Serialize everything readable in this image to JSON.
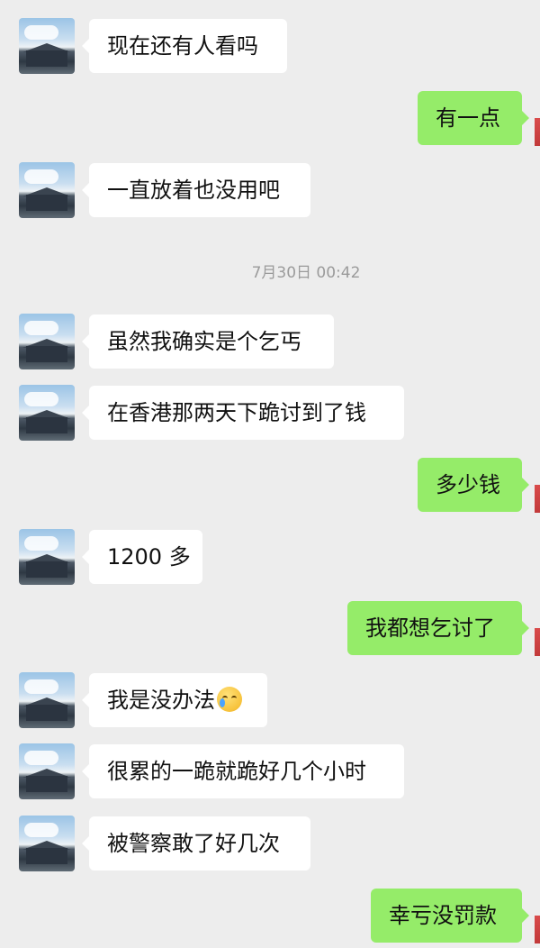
{
  "conversation": {
    "messages": [
      {
        "sender": "other",
        "text": "现在还有人看吗"
      },
      {
        "sender": "self",
        "text": "有一点"
      },
      {
        "sender": "other",
        "text": "一直放着也没用吧"
      },
      {
        "sender": "other",
        "text": "虽然我确实是个乞丐"
      },
      {
        "sender": "other",
        "text": "在香港那两天下跪讨到了钱"
      },
      {
        "sender": "self",
        "text": "多少钱"
      },
      {
        "sender": "other",
        "text": "1200 多"
      },
      {
        "sender": "self",
        "text": "我都想乞讨了"
      },
      {
        "sender": "other",
        "text": "我是没办法",
        "emoji": "crying-laughing-emoji"
      },
      {
        "sender": "other",
        "text": "很累的一跪就跪好几个小时"
      },
      {
        "sender": "other",
        "text": "被警察敢了好几次"
      },
      {
        "sender": "self",
        "text": "幸亏没罚款"
      }
    ],
    "timestamp": "7月30日 00:42"
  },
  "colors": {
    "background": "#ededed",
    "incoming_bubble": "#ffffff",
    "outgoing_bubble": "#95ec69",
    "timestamp_text": "#9b9b9b"
  }
}
